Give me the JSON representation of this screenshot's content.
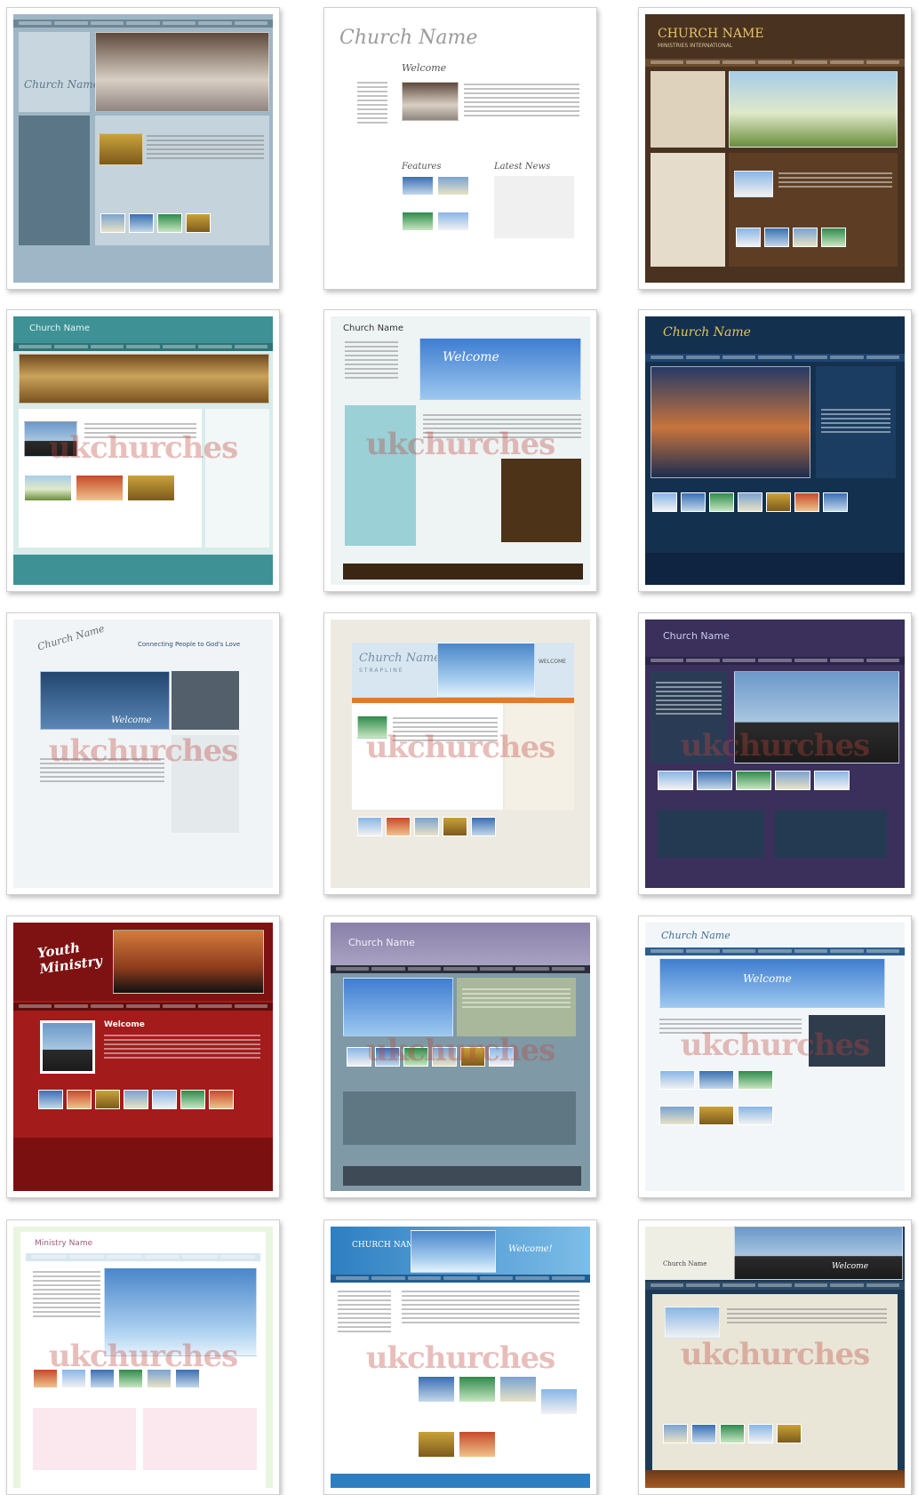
{
  "tiles": [
    {
      "id": 1,
      "name": "Church Name"
    },
    {
      "id": 2,
      "name": "Church Name",
      "welcome": "Welcome",
      "features": "Features",
      "latest_news": "Latest News"
    },
    {
      "id": 3,
      "name": "CHURCH NAME",
      "tagline": "MINISTRIES INTERNATIONAL"
    },
    {
      "id": 4,
      "name": "Church Name"
    },
    {
      "id": 5,
      "name": "Church Name",
      "welcome": "Welcome"
    },
    {
      "id": 6,
      "name": "Church Name"
    },
    {
      "id": 7,
      "name": "Church Name",
      "tagline": "Connecting People to God's Love",
      "welcome": "Welcome"
    },
    {
      "id": 8,
      "name": "Church Name",
      "tagline": "STRAPLINE",
      "welcome": "WELCOME"
    },
    {
      "id": 9,
      "name": "Church Name"
    },
    {
      "id": 10,
      "name": "Youth Ministry",
      "welcome": "Welcome"
    },
    {
      "id": 11,
      "name": "Church Name"
    },
    {
      "id": 12,
      "name": "Church Name",
      "welcome": "Welcome"
    },
    {
      "id": 13,
      "name": "Ministry Name"
    },
    {
      "id": 14,
      "name": "CHURCH NAME",
      "welcome": "Welcome!"
    },
    {
      "id": 15,
      "name": "Church Name",
      "welcome": "Welcome"
    }
  ],
  "watermark": "ukchurches",
  "colors": {
    "teal": "#3e9296",
    "brown": "#4a3220",
    "navy": "#14304f",
    "red": "#a31b1b",
    "purple": "#3b2f5c"
  }
}
